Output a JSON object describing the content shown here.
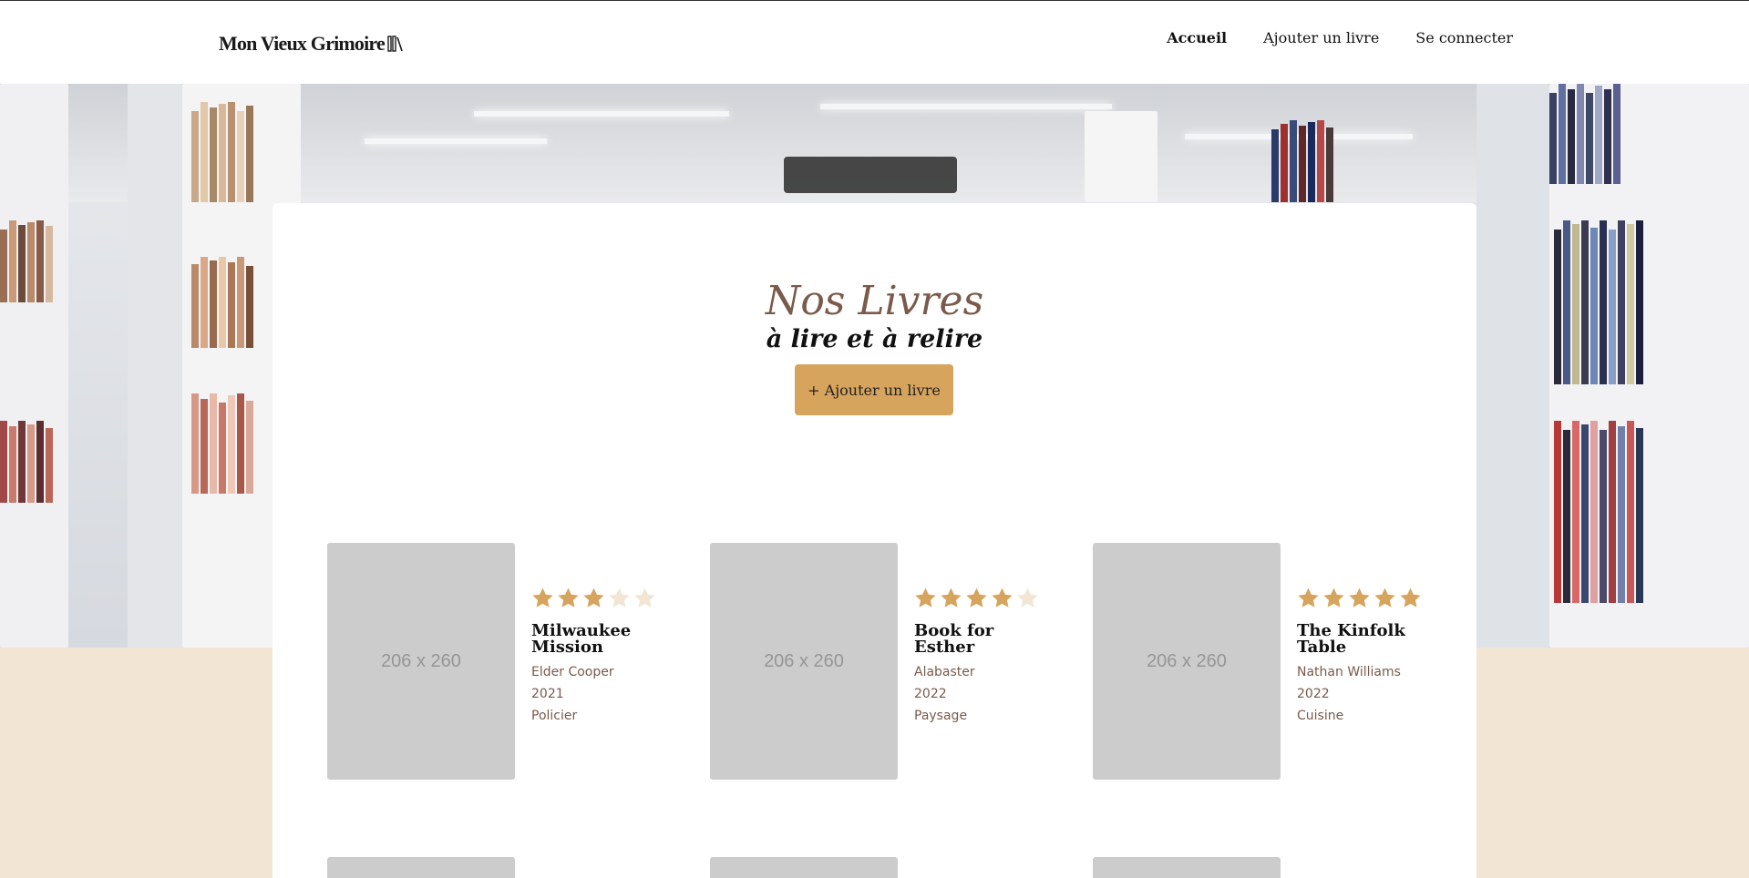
{
  "header": {
    "logo_text": "Mon Vieux Grimoire",
    "nav": [
      "Accueil",
      "Ajouter un livre",
      "Se connecter"
    ]
  },
  "main": {
    "title": "Nos Livres",
    "subtitle": "à lire et à relire",
    "add_button": "+ Ajouter un livre"
  },
  "books": [
    {
      "placeholder": "206 x 260",
      "rating": 3,
      "title": "Milwaukee Mission",
      "author": "Elder Cooper",
      "year": "2021",
      "genre": "Policier"
    },
    {
      "placeholder": "206 x 260",
      "rating": 4,
      "title": "Book for Esther",
      "author": "Alabaster",
      "year": "2022",
      "genre": "Paysage"
    },
    {
      "placeholder": "206 x 260",
      "rating": 5,
      "title": "The Kinfolk Table",
      "author": "Nathan Williams",
      "year": "2022",
      "genre": "Cuisine"
    }
  ],
  "colors": {
    "accent": "#d6a45c",
    "star_empty": "#f2e5d4",
    "title_brown": "#7a5a4a",
    "page_bg": "#f2e5d4"
  },
  "icons": {
    "logo": "bookshelf-icon",
    "star": "star-icon"
  }
}
